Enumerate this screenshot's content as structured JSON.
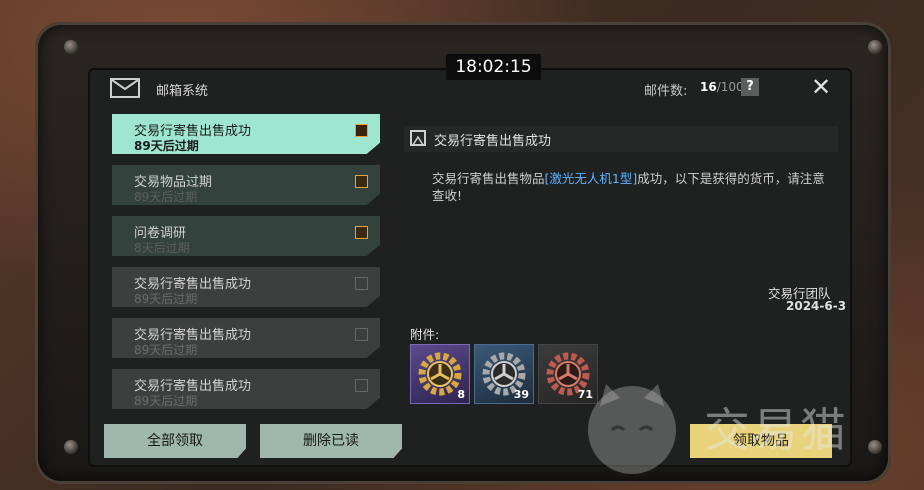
{
  "clock": "18:02:15",
  "header": {
    "title": "邮箱系统",
    "mail_count_label": "邮件数:",
    "mail_count_current": "16",
    "mail_count_max": "/100",
    "help": "?",
    "close": "✕"
  },
  "mails": [
    {
      "subject": "交易行寄售出售成功",
      "expiry": "89天后过期"
    },
    {
      "subject": "交易物品过期",
      "expiry": "89天后过期"
    },
    {
      "subject": "问卷调研",
      "expiry": "8天后过期"
    },
    {
      "subject": "交易行寄售出售成功",
      "expiry": "89天后过期"
    },
    {
      "subject": "交易行寄售出售成功",
      "expiry": "89天后过期"
    },
    {
      "subject": "交易行寄售出售成功",
      "expiry": "89天后过期"
    }
  ],
  "buttons": {
    "claim_all": "全部领取",
    "delete_read": "删除已读",
    "claim_items": "领取物品"
  },
  "detail": {
    "title": "交易行寄售出售成功",
    "body_before": "交易行寄售出售物品",
    "body_item": "[激光无人机1型]",
    "body_after": "成功，以下是获得的货币，请注意查收!",
    "sender": "交易行团队",
    "date": "2024-6-3",
    "attachments_label": "附件:",
    "attachments": [
      {
        "name": "gold-gear-coin",
        "qty": "8"
      },
      {
        "name": "silver-gear-coin",
        "qty": "39"
      },
      {
        "name": "red-gear-coin",
        "qty": "71"
      }
    ]
  },
  "watermark": "交易猫",
  "colors": {
    "accent_mint": "#9ee6cf",
    "button_green": "#9fb7ad",
    "claim_yellow": "#e8d37a",
    "highlight_blue": "#5eb3ff",
    "gift_orange": "#e8a33a"
  }
}
